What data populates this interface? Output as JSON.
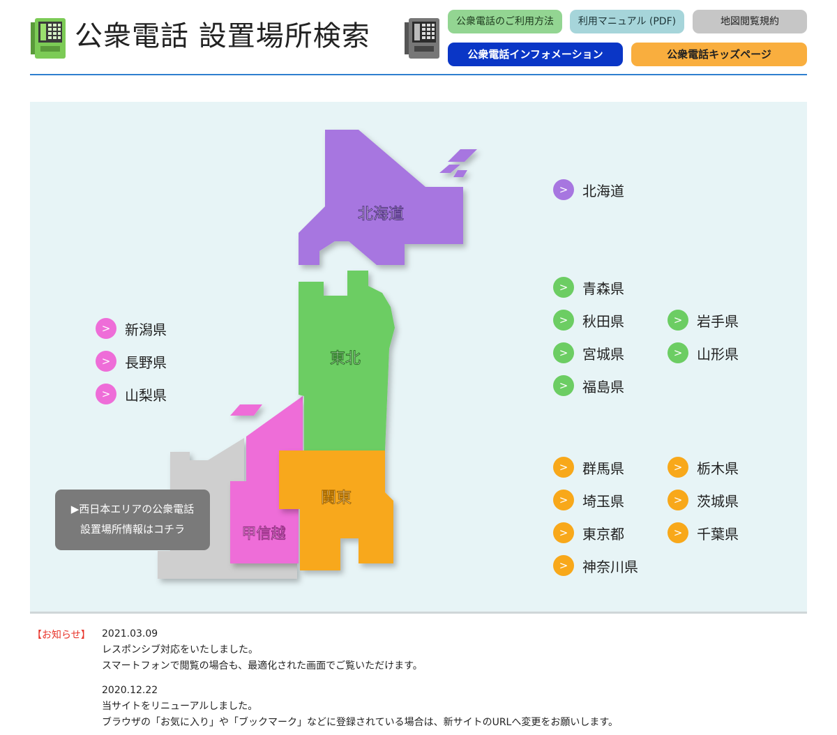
{
  "header": {
    "title": "公衆電話 設置場所検索",
    "buttons": {
      "usage": "公衆電話のご利用方法",
      "manual": "利用マニュアル (PDF)",
      "terms": "地図閲覧規約",
      "info": "公衆電話インフォメーション",
      "kids": "公衆電話キッズページ"
    }
  },
  "map": {
    "regions": {
      "hokkaido": "北海道",
      "tohoku": "東北",
      "kanto": "関東",
      "koshinetsu": "甲信越"
    },
    "colors": {
      "hokkaido": "#a776e0",
      "tohoku": "#6ccd63",
      "koshinetsu": "#ee6dd8",
      "kanto": "#f8a81a",
      "west": "#cfcfcf"
    },
    "west_link": [
      "▶西日本エリアの公衆電話",
      "設置場所情報はコチラ"
    ],
    "bullet_symbol": ">",
    "prefectures": {
      "hokkaido": [
        "北海道"
      ],
      "tohoku": [
        "青森県",
        "秋田県",
        "岩手県",
        "宮城県",
        "山形県",
        "福島県"
      ],
      "koshinetsu": [
        "新潟県",
        "長野県",
        "山梨県"
      ],
      "kanto": [
        "群馬県",
        "栃木県",
        "埼玉県",
        "茨城県",
        "東京都",
        "千葉県",
        "神奈川県"
      ]
    }
  },
  "news": {
    "label": "【お知らせ】",
    "items": [
      {
        "date": "2021.03.09",
        "lines": [
          "レスポンシブ対応をいたしました。",
          "スマートフォンで閲覧の場合も、最適化された画面でご覧いただけます。"
        ]
      },
      {
        "date": "2020.12.22",
        "lines": [
          "当サイトをリニューアルしました。",
          "ブラウザの「お気に入り」や「ブックマーク」などに登録されている場合は、新サイトのURLへ変更をお願いします。"
        ]
      }
    ]
  }
}
